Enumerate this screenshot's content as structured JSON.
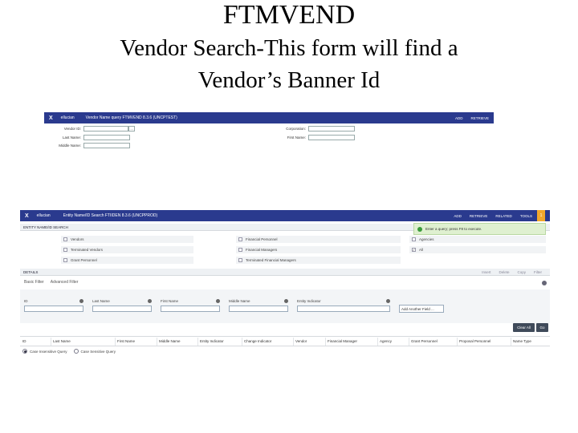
{
  "slide": {
    "title": "FTMVEND",
    "subtitle_line1": "Vendor Search-This form will find a",
    "subtitle_line2": "Vendor’s Banner Id"
  },
  "screen1": {
    "close": "X",
    "logo": "ellucian",
    "title": "Vendor Name query FTMVEND 8.3.6 (UNCPTEST)",
    "actions": [
      "ADD",
      "RETRIEVE"
    ],
    "fields_left": [
      {
        "label": "Vendor ID:",
        "value": ""
      },
      {
        "label": "Last Name:",
        "value": ""
      },
      {
        "label": "Middle Name:",
        "value": ""
      }
    ],
    "fields_right": [
      {
        "label": "Corporation:",
        "value": ""
      },
      {
        "label": "First Name:",
        "value": ""
      }
    ],
    "lookup_symbol": "..."
  },
  "screen2": {
    "close": "X",
    "logo": "ellucian",
    "title": "Entity Name/ID Search FTIIDEN 8.3.6 (UNCPPROD)",
    "actions": [
      "ADD",
      "RETRIEVE",
      "RELATED",
      "TOOLS"
    ],
    "badge": "1",
    "section1_title": "ENTITY NAME/ID SEARCH",
    "checkboxes": [
      [
        "Vendors",
        "Financial Personnel",
        "Agencies"
      ],
      [
        "Terminated Vendors",
        "Financial Managers",
        "All"
      ],
      [
        "Grant Personnel",
        "Terminated Financial Managers",
        ""
      ]
    ],
    "all_checked": true,
    "notice": "Enter a query; press F8 to execute.",
    "section2_title": "DETAILS",
    "section2_tools": [
      "Insert",
      "Delete",
      "Copy",
      "Filter"
    ],
    "filter_tabs": [
      "Basic Filter",
      "Advanced Filter"
    ],
    "filter_fields": [
      "ID",
      "Last Name",
      "First Name",
      "Middle Name",
      "Entity Indicator"
    ],
    "add_field": "Add Another Field ...",
    "buttons": {
      "clear_all": "Clear All",
      "go": "Go"
    },
    "columns": [
      "ID",
      "Last Name",
      "First Name",
      "Middle Name",
      "Entity Indicator",
      "Change Indicator",
      "Vendor",
      "Financial Manager",
      "Agency",
      "Grant Personnel",
      "Proposal Personnel",
      "Name Type"
    ],
    "query_options": [
      "Case Insensitive Query",
      "Case Sensitive Query"
    ]
  }
}
